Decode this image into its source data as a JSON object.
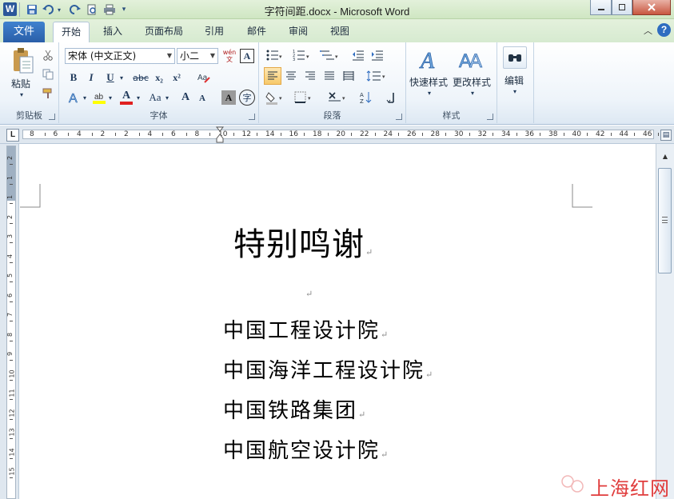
{
  "window": {
    "title": "字符间距.docx - Microsoft Word",
    "logo": "W"
  },
  "tabs": {
    "file": "文件",
    "items": [
      "开始",
      "插入",
      "页面布局",
      "引用",
      "邮件",
      "审阅",
      "视图"
    ],
    "active": "开始"
  },
  "ribbon": {
    "clipboard": {
      "paste": "粘贴",
      "label": "剪贴板"
    },
    "font": {
      "family": "宋体 (中文正文)",
      "size": "小二",
      "label": "字体",
      "bold": "B",
      "italic": "I",
      "underline": "U",
      "strike": "abc",
      "subscript": "x₂",
      "superscript": "x²",
      "font_color_glyph": "A",
      "change_case": "Aa",
      "grow": "A",
      "shrink": "A",
      "char_shading": "A",
      "enclose": "字",
      "phonetic": "wén 文",
      "char_border": "A"
    },
    "paragraph": {
      "label": "段落"
    },
    "styles": {
      "quick": "快速样式",
      "change": "更改样式",
      "label": "样式"
    },
    "editing": {
      "label": "编辑"
    }
  },
  "ruler": {
    "corner": "L",
    "h_numbers": [
      "8",
      "6",
      "4",
      "2",
      "2",
      "4",
      "6",
      "8",
      "10",
      "12",
      "14",
      "16",
      "18",
      "20",
      "22",
      "24",
      "26",
      "28",
      "30",
      "32",
      "34",
      "36",
      "38",
      "40",
      "42",
      "44",
      "46"
    ],
    "v_numbers": [
      "2",
      "1",
      "1",
      "2",
      "3",
      "4",
      "5",
      "6",
      "7",
      "8",
      "9",
      "10",
      "11",
      "12",
      "13",
      "14",
      "15"
    ]
  },
  "document": {
    "title": "特别鸣谢",
    "organizations": [
      "中国工程设计院",
      "中国海洋工程设计院",
      "中国铁路集团",
      "中国航空设计院"
    ],
    "paragraph_mark": "↵"
  },
  "watermark": {
    "text": "上海红网"
  },
  "colors": {
    "file_tab": "#2a5ea8",
    "title_bar": "#d6ead0",
    "watermark": "#e03c3c"
  }
}
